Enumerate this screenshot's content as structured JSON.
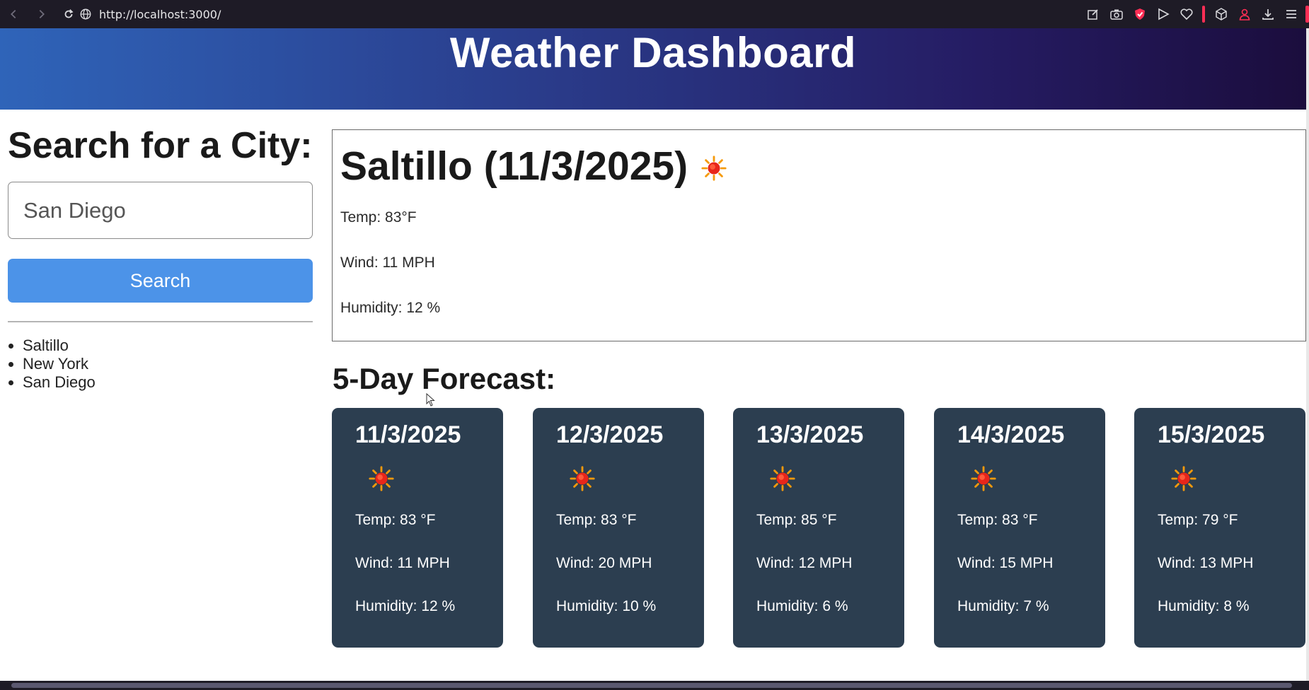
{
  "browser": {
    "url": "http://localhost:3000/",
    "accent_color": "#ff2e55",
    "icons": [
      "back-icon",
      "forward-icon",
      "reload-icon",
      "globe-icon",
      "edit-icon",
      "camera-icon",
      "shield-icon",
      "send-icon",
      "heart-icon",
      "cube-icon",
      "person-icon",
      "download-icon",
      "menu-icon"
    ]
  },
  "header": {
    "title": "Weather Dashboard"
  },
  "sidebar": {
    "heading": "Search for a City:",
    "input_value": "San Diego",
    "search_button": "Search",
    "button_color": "#4c93e8",
    "history": [
      "Saltillo",
      "New York",
      "San Diego"
    ]
  },
  "today": {
    "title": "Saltillo (11/3/2025)",
    "icon": "sun-icon",
    "temp": "Temp: 83°F",
    "wind": "Wind: 11 MPH",
    "humidity": "Humidity: 12 %"
  },
  "forecast": {
    "heading": "5-Day Forecast:",
    "card_color": "#2c3e50",
    "days": [
      {
        "date": "11/3/2025",
        "icon": "sun-icon",
        "temp": "Temp: 83 °F",
        "wind": "Wind: 11 MPH",
        "humidity": "Humidity: 12 %"
      },
      {
        "date": "12/3/2025",
        "icon": "sun-icon",
        "temp": "Temp: 83 °F",
        "wind": "Wind: 20 MPH",
        "humidity": "Humidity: 10 %"
      },
      {
        "date": "13/3/2025",
        "icon": "sun-icon",
        "temp": "Temp: 85 °F",
        "wind": "Wind: 12 MPH",
        "humidity": "Humidity: 6 %"
      },
      {
        "date": "14/3/2025",
        "icon": "sun-icon",
        "temp": "Temp: 83 °F",
        "wind": "Wind: 15 MPH",
        "humidity": "Humidity: 7 %"
      },
      {
        "date": "15/3/2025",
        "icon": "sun-icon",
        "temp": "Temp: 79 °F",
        "wind": "Wind: 13 MPH",
        "humidity": "Humidity: 8 %"
      }
    ]
  }
}
